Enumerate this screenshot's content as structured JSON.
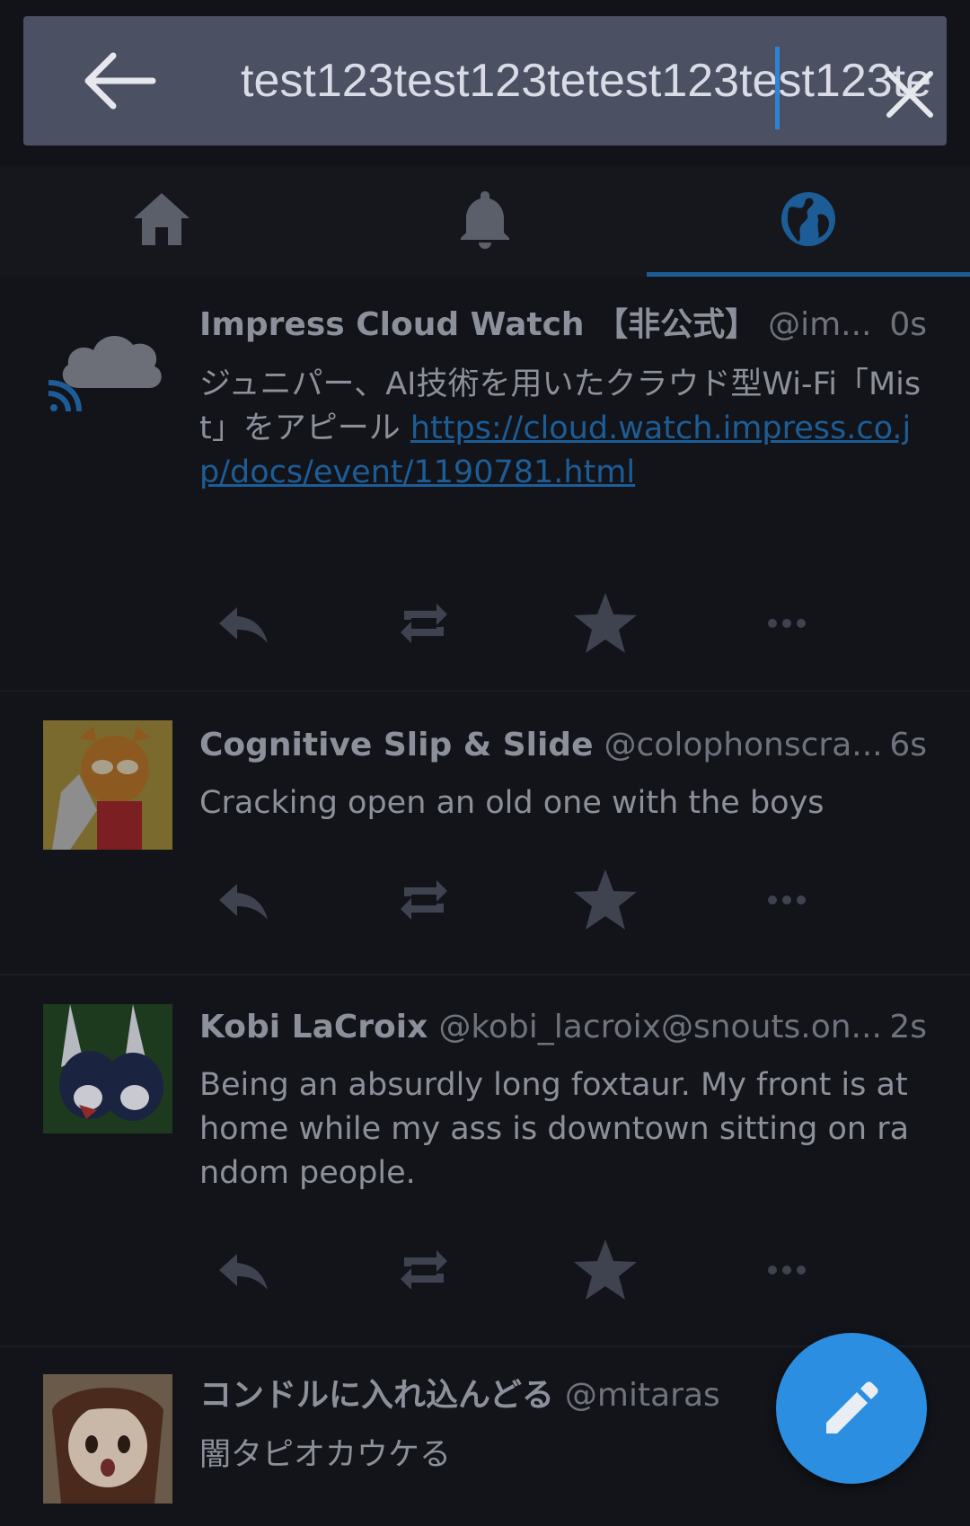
{
  "search": {
    "query": "test123test123tetest123test123te"
  },
  "tabs": [
    {
      "name": "home-icon",
      "active": false
    },
    {
      "name": "bell-icon",
      "active": false
    },
    {
      "name": "globe-icon",
      "active": true
    }
  ],
  "statuses": [
    {
      "display_name": "Impress Cloud Watch 【非公式】",
      "acct": "@im...",
      "time": "0s",
      "content": "ジュニパー、AI技術を用いたクラウド型Wi-Fi「Mist」をアピール",
      "link": "https://cloud.watch.impress.co.jp/docs/event/1190781.html"
    },
    {
      "display_name": "Cognitive Slip & Slide",
      "acct": "@colophonscra...",
      "time": "6s",
      "content": "Cracking open an old one with the boys"
    },
    {
      "display_name": "Kobi LaCroix",
      "acct": "@kobi_lacroix@snouts.on...",
      "time": "2s",
      "content": "Being an absurdly long foxtaur. My front is at home while my ass is downtown sitting on random people."
    },
    {
      "display_name": "コンドルに入れ込んどる",
      "acct": "@mitaras",
      "time": "",
      "content": "闇タピオカウケる"
    }
  ],
  "icons": {
    "reply": "reply-icon",
    "boost": "boost-icon",
    "favourite": "star-icon",
    "more": "more-icon",
    "compose": "pencil-icon"
  },
  "colors": {
    "accent": "#2b8ee0",
    "searchbar": "#4b5063",
    "background": "#111318"
  }
}
